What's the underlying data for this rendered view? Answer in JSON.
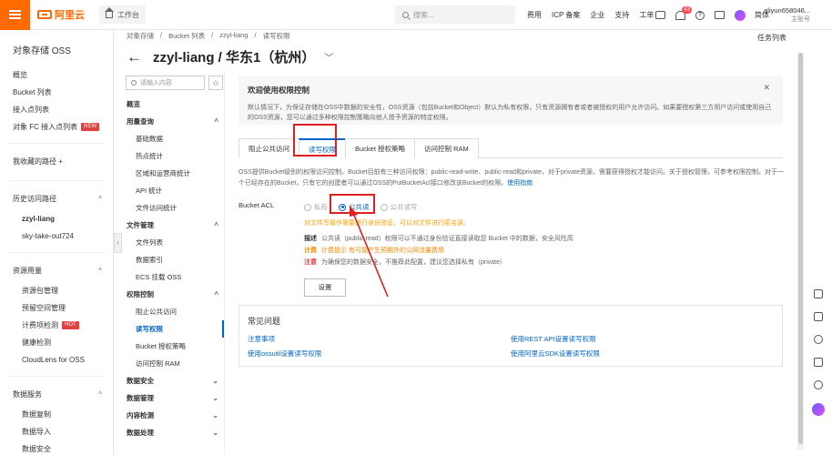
{
  "topbar": {
    "logo": "阿里云",
    "workbench": "工作台",
    "search_placeholder": "搜索...",
    "links": [
      "费用",
      "ICP 备案",
      "企业",
      "支持",
      "工单"
    ],
    "notification_count": "43",
    "lang": "简体",
    "user_name": "aliyun658046...",
    "user_role": "主账号"
  },
  "sidebar": {
    "title": "对象存储 OSS",
    "items": [
      {
        "label": "概览"
      },
      {
        "label": "Bucket 列表"
      },
      {
        "label": "接入点列表"
      },
      {
        "label": "对象 FC 接入点列表",
        "tag": "NEW"
      }
    ],
    "favorites": "我收藏的路径",
    "history_title": "历史访问路径",
    "history": [
      "zzyl-liang",
      "sky-take-out724"
    ],
    "resource_title": "资源用量",
    "resource_items": [
      {
        "label": "资源包管理"
      },
      {
        "label": "预留空间管理"
      },
      {
        "label": "计费项检测",
        "tag": "HOT"
      },
      {
        "label": "健康检测"
      },
      {
        "label": "CloudLens for OSS"
      }
    ],
    "data_title": "数据服务",
    "data_items": [
      "数据复制",
      "数据导入",
      "数据安全"
    ]
  },
  "breadcrumb": [
    "对象存储",
    "/",
    "Bucket 列表",
    "/",
    "zzyl-liang",
    "/",
    "读写权限"
  ],
  "task_list": "任务列表",
  "page_title": "zzyl-liang / 华东1（杭州）",
  "subnav": {
    "search_placeholder": "请输入内容",
    "items": [
      {
        "label": "概览",
        "type": "group"
      },
      {
        "label": "用量查询",
        "type": "group",
        "chev": "^"
      },
      {
        "label": "基础数据",
        "type": "child"
      },
      {
        "label": "热点统计",
        "type": "child"
      },
      {
        "label": "区域和运营商统计",
        "type": "child"
      },
      {
        "label": "API 统计",
        "type": "child"
      },
      {
        "label": "文件访问统计",
        "type": "child"
      },
      {
        "label": "文件管理",
        "type": "group",
        "chev": "^"
      },
      {
        "label": "文件列表",
        "type": "child"
      },
      {
        "label": "数据索引",
        "type": "child"
      },
      {
        "label": "ECS 挂载 OSS",
        "type": "child"
      },
      {
        "label": "权限控制",
        "type": "group",
        "chev": "^"
      },
      {
        "label": "阻止公共访问",
        "type": "child"
      },
      {
        "label": "读写权限",
        "type": "child",
        "active": true
      },
      {
        "label": "Bucket 授权策略",
        "type": "child"
      },
      {
        "label": "访问控制 RAM",
        "type": "child"
      },
      {
        "label": "数据安全",
        "type": "group",
        "chev": "v"
      },
      {
        "label": "数据管理",
        "type": "group",
        "chev": "v"
      },
      {
        "label": "内容检测",
        "type": "group",
        "chev": "v"
      },
      {
        "label": "数据处理",
        "type": "group",
        "chev": "v"
      }
    ]
  },
  "welcome": {
    "title": "欢迎使用权限控制",
    "text": "默认情况下，为保证存储在OSS中数据的安全性，OSS资源（包括Bucket和Object）默认为私有权限，只有资源拥有者或者被授权的用户允许访问。如果要授权第三方用户访问或使用自己的OSS资源，您可以通过多种权限控制策略向他人授予资源的特定权限。"
  },
  "tabs": [
    "阻止公共访问",
    "读写权限",
    "Bucket 授权策略",
    "访问控制 RAM"
  ],
  "description": "OSS提供Bucket级别的权限访问控制。Bucket目前有三种访问权限：public-read-write、public-read和private，对于private资源，需要获得授权才能访问。关于授权管理，可参考权限控制。对于一个已经存在的Bucket，只有它的创建者可以通过OSS的PutBucketAcl接口修改该Bucket的权限。",
  "doc_link": "使用指南",
  "acl": {
    "label": "Bucket ACL",
    "options": [
      "私有",
      "公共读",
      "公共读写"
    ],
    "selected_index": 1,
    "warning": "对文件写操作需要进行身份验证，可以对文件进行匿名读。",
    "info": [
      {
        "key": "描述",
        "text": "公共读（public-read）权限可以不通过身份验证直接读取您 Bucket 中的数据，安全风险高",
        "style": "normal"
      },
      {
        "key": "计费",
        "text": "计费提示 有可能产生预期外的公网流量费用",
        "style": "orange"
      },
      {
        "key": "注意",
        "text": "为确保您的数据安全，不推荐此配置，建议您选择私有（private）",
        "style": "red"
      }
    ],
    "button": "设置"
  },
  "faq": {
    "title": "常见问题",
    "links": [
      "注意事项",
      "使用REST API设置读写权限",
      "使用ossutil设置读写权限",
      "使用阿里云SDK设置读写权限"
    ]
  },
  "colors": {
    "accent": "#0064c8",
    "brand": "#ff6a00",
    "annotation": "#e02020"
  }
}
